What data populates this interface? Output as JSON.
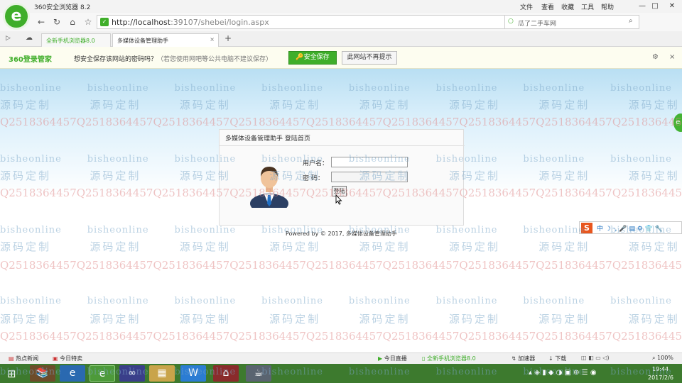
{
  "window": {
    "title": "360安全浏览器 8.2",
    "menu": [
      "文件",
      "查看",
      "收藏",
      "工具",
      "帮助"
    ],
    "controls": [
      "—",
      "□",
      "✕"
    ]
  },
  "address_bar": {
    "url_host": "http://localhost",
    "url_rest": ":39107/shebei/login.aspx",
    "search_text": "瓜了二手车网"
  },
  "tabs": [
    {
      "label": "全新手机浏览器8.0",
      "active": false
    },
    {
      "label": "多媒体设备管理助手",
      "active": true
    }
  ],
  "notification": {
    "brand": "360登录管家",
    "question": "想安全保存该网站的密码吗？",
    "hint": "（若您使用网吧等公共电脑不建议保存）",
    "save_label": "安全保存",
    "never_label": "此网站不再提示"
  },
  "watermark": {
    "line_a": "bisheonline",
    "line_b": "源码定制",
    "line_c": "Q2518364457"
  },
  "login": {
    "title": "多媒体设备管理助手   登陆首页",
    "username_label": "用户名：",
    "username_value": "",
    "password_label": "密  码：",
    "password_value": "",
    "submit_label": "登陆",
    "footer": "Powered by © 2017, 多媒体设备管理助手"
  },
  "statusbar": {
    "left": [
      "热点新闻",
      "今日特卖"
    ],
    "right": [
      "今日直播",
      "全新手机浏览器8.0",
      "加速器",
      "下载",
      "100%"
    ]
  },
  "taskbar": {
    "time": "19:44",
    "date": "2017/2/6"
  },
  "colors": {
    "brand_green": "#3fae2a",
    "taskbar": "#3d7a2e",
    "watermark_red": "#e08a8a",
    "watermark_blue": "#7aa6c8"
  }
}
